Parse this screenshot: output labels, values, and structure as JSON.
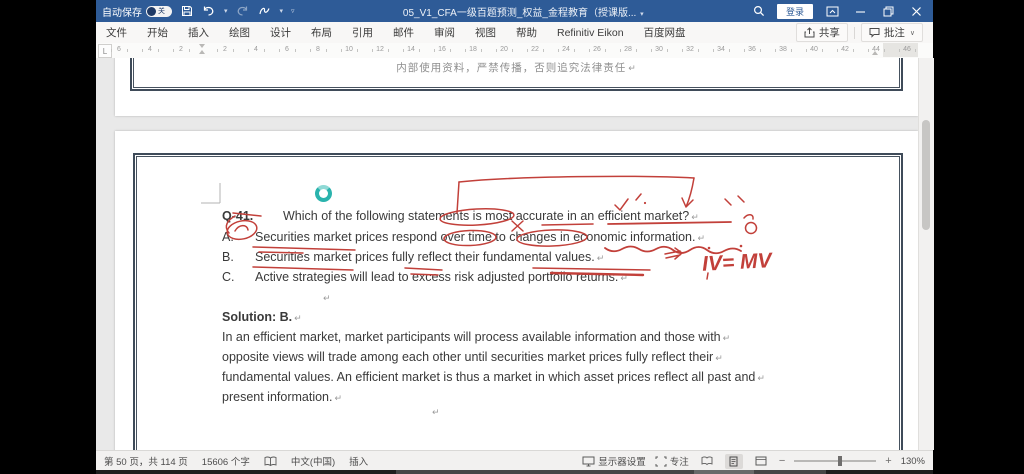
{
  "titlebar": {
    "autosave_label": "自动保存",
    "autosave_state": "关",
    "title": "05_V1_CFA一级百题预测_权益_金程教育（授课版...",
    "title_caret": "▾",
    "login_label": "登录"
  },
  "ribbon": {
    "tabs": [
      "文件",
      "开始",
      "插入",
      "绘图",
      "设计",
      "布局",
      "引用",
      "邮件",
      "审阅",
      "视图",
      "帮助",
      "Refinitiv Eikon",
      "百度网盘"
    ],
    "share_label": "共享",
    "comments_label": "批注",
    "comments_caret": "∨"
  },
  "ruler": {
    "tab_selector": "L",
    "left_numbers": [
      "6",
      "4",
      "2"
    ],
    "numbers": [
      "2",
      "4",
      "6",
      "8",
      "10",
      "12",
      "14",
      "16",
      "18",
      "20",
      "22",
      "24",
      "26",
      "28",
      "30",
      "32",
      "34",
      "36",
      "38",
      "40",
      "42",
      "44",
      "46"
    ]
  },
  "document": {
    "pilcrow": "↵",
    "page1_footer": "内部使用资料，严禁传播，否则追究法律责任",
    "question": {
      "number": "Q-41.",
      "stem": "Which of the following statements is most accurate in an efficient market?",
      "options": [
        {
          "label": "A.",
          "text": "Securities market prices respond over time to changes in economic information."
        },
        {
          "label": "B.",
          "text": "Securities market prices fully reflect their fundamental values."
        },
        {
          "label": "C.",
          "text": "Active strategies will lead to excess risk adjusted portfolio returns."
        }
      ]
    },
    "solution": {
      "heading": "Solution: B.",
      "lines": [
        "In an efficient market, market participants will process available information and those with",
        "opposite views will trade among each other until securities market prices fully reflect their",
        "fundamental values. An efficient market is thus a market in which asset prices reflect all past and",
        "present information."
      ]
    },
    "annotations": {
      "handwriting": "IV= MV",
      "color": "#c2403a"
    }
  },
  "statusbar": {
    "page_info": "第 50 页，共 114 页",
    "word_count": "15606 个字",
    "language": "中文(中国)",
    "insert_mode": "插入",
    "display_settings": "显示器设置",
    "focus": "专注",
    "zoom_out": "−",
    "zoom_in": "+",
    "zoom_level": "130%"
  },
  "colors": {
    "titlebar_blue": "#2e5b97",
    "annotation_red": "#c2403a",
    "donut_teal": "#2ab3ad"
  }
}
